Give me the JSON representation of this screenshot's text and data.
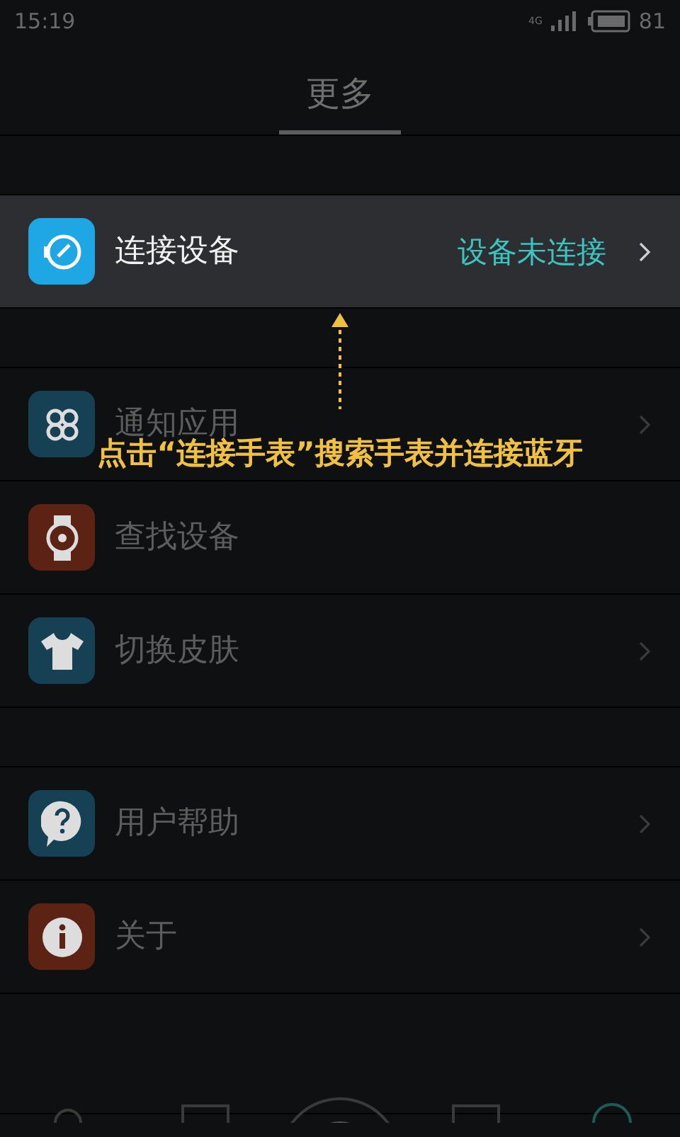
{
  "status_bar": {
    "time": "15:19",
    "network": "4G",
    "battery": "81"
  },
  "header": {
    "title": "更多"
  },
  "sections": [
    {
      "items": [
        {
          "label": "连接设备",
          "kind": "link",
          "color": "#1ea7e4",
          "value": "设备未连接",
          "chevron": true,
          "highlighted": true
        }
      ]
    },
    {
      "items": [
        {
          "label": "通知应用",
          "kind": "clover",
          "color": "#164154",
          "chevron": true,
          "highlighted": false
        },
        {
          "label": "查找设备",
          "kind": "watch",
          "color": "#5c2213",
          "chevron": false,
          "highlighted": false
        },
        {
          "label": "切换皮肤",
          "kind": "shirt",
          "color": "#164154",
          "chevron": true,
          "highlighted": false
        }
      ]
    },
    {
      "items": [
        {
          "label": "用户帮助",
          "kind": "help",
          "color": "#164154",
          "chevron": true,
          "highlighted": false
        },
        {
          "label": "关于",
          "kind": "info",
          "color": "#5c2213",
          "chevron": true,
          "highlighted": false
        }
      ]
    }
  ],
  "callout": {
    "text": "点击“连接手表”搜索手表并连接蓝牙"
  }
}
